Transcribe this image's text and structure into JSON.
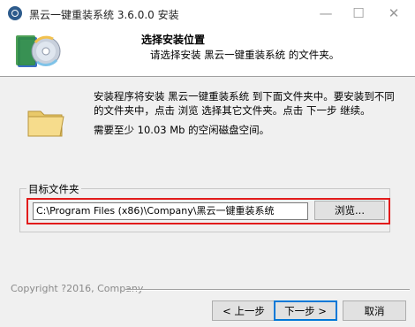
{
  "window": {
    "title": "黑云一键重装系统 3.6.0.0 安装",
    "min_glyph": "—",
    "max_glyph": "☐",
    "close_glyph": "✕"
  },
  "header": {
    "title": "选择安装位置",
    "subtitle": "请选择安装 黑云一键重装系统 的文件夹。"
  },
  "body": {
    "description": "安装程序将安装 黑云一键重装系统 到下面文件夹中。要安装到不同的文件夹中，点击 浏览 选择其它文件夹。点击 下一步 继续。",
    "space_required": "需要至少 10.03 Mb 的空闲磁盘空间。"
  },
  "destination": {
    "label": "目标文件夹",
    "path": "C:\\Program Files (x86)\\Company\\黑云一键重装系统",
    "browse_label": "浏览..."
  },
  "footer": {
    "copyright": "Copyright ?2016, Company",
    "back_label": "< 上一步",
    "next_label": "下一步 >",
    "cancel_label": "取消"
  },
  "colors": {
    "highlight_border": "#e21b1b",
    "default_button_border": "#0078d7",
    "app_icon": "#2d5b8c"
  },
  "icons": {
    "app": "app-logo-icon",
    "header": "installer-cd-icon",
    "folder": "folder-icon"
  }
}
